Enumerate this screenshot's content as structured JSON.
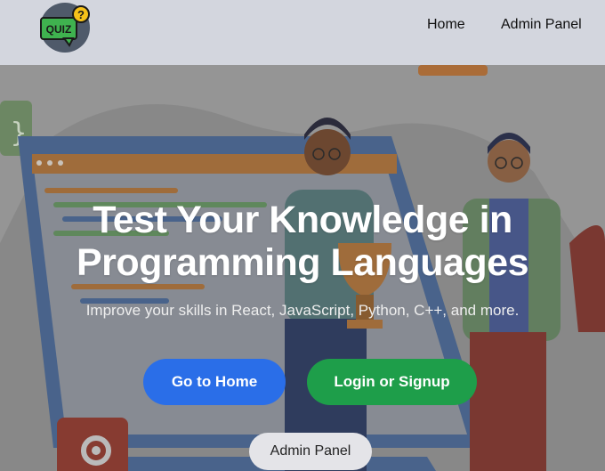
{
  "nav": {
    "logo_text": "QUIZ",
    "links": [
      "Home",
      "Admin Panel"
    ]
  },
  "hero": {
    "title_line1": "Test Your Knowledge in",
    "title_line2": "Programming Languages",
    "subtitle": "Improve your skills in React, JavaScript, Python, C++, and more.",
    "buttons": {
      "home": "Go to Home",
      "login": "Login or Signup",
      "admin": "Admin Panel"
    }
  },
  "colors": {
    "primary_button": "#2a6ee8",
    "success_button": "#1e9e4a",
    "navbar_bg": "#d3d6de"
  }
}
